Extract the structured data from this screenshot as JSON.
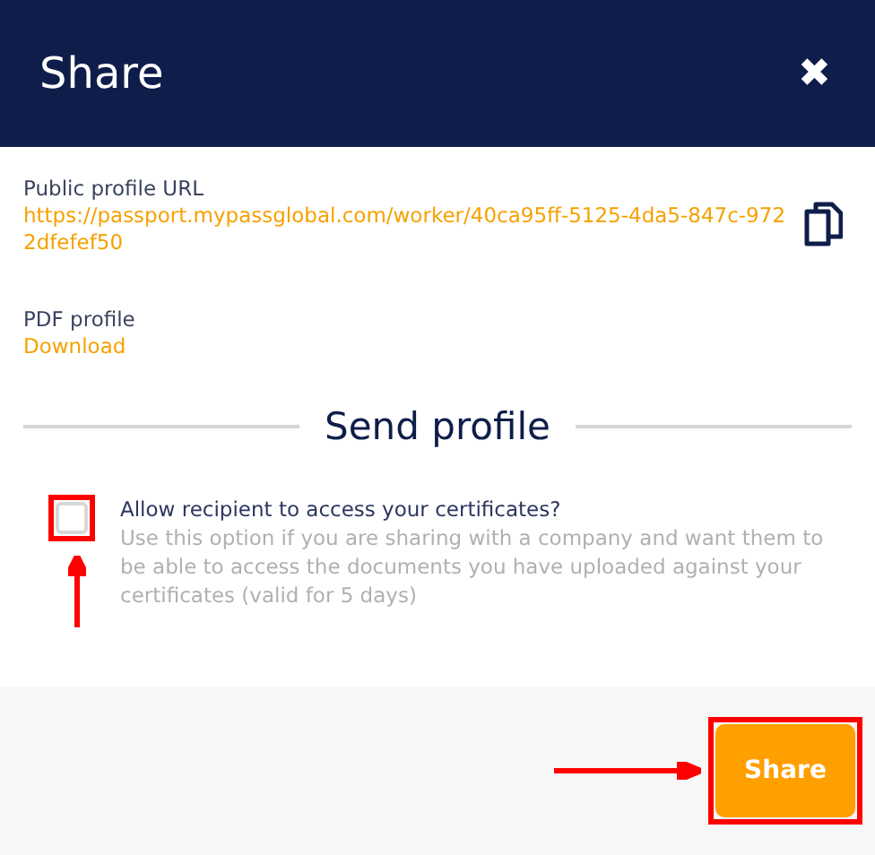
{
  "dialog": {
    "title": "Share",
    "close_icon": "✖"
  },
  "public_url": {
    "label": "Public profile URL",
    "value": "https://passport.mypassglobal.com/worker/40ca95ff-5125-4da5-847c-9722dfefef50"
  },
  "pdf": {
    "label": "PDF profile",
    "link": "Download"
  },
  "section_title": "Send profile",
  "certificates_option": {
    "checked": false,
    "highlighted": true,
    "label": "Allow recipient to access your certificates?",
    "description": "Use this option if you are sharing with a company and want them to be able to access the documents you have uploaded against your certificates (valid for 5 days)"
  },
  "share_button": {
    "label": "Share",
    "highlighted": true
  }
}
